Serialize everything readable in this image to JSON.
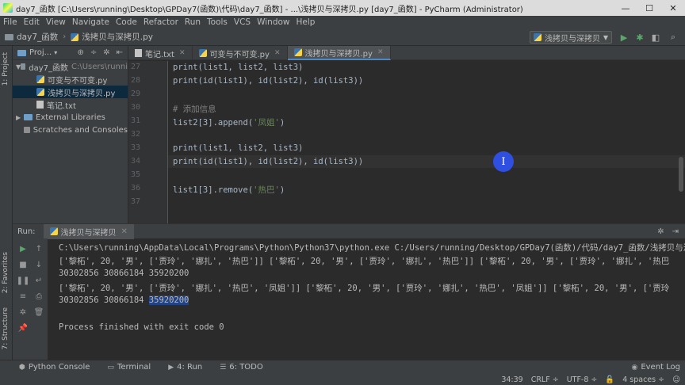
{
  "window": {
    "title": "day7_函数 [C:\\Users\\running\\Desktop\\GPDay7(函数)\\代码\\day7_函数] - ...\\浅拷贝与深拷贝.py [day7_函数] - PyCharm (Administrator)",
    "controls": [
      "—",
      "☐",
      "✕"
    ]
  },
  "menu": [
    "File",
    "Edit",
    "View",
    "Navigate",
    "Code",
    "Refactor",
    "Run",
    "Tools",
    "VCS",
    "Window",
    "Help"
  ],
  "breadcrumb": {
    "project": "day7_函数",
    "file": "浅拷贝与深拷贝.py"
  },
  "run_config": {
    "label": "浅拷贝与深拷贝"
  },
  "left_strip": {
    "project_tab": "1: Project",
    "favorites_tab": "2: Favorites",
    "structure_tab": "7: Structure"
  },
  "project_panel": {
    "header": "Proj...",
    "root": {
      "name": "day7_函数",
      "path": "C:\\Users\\runni"
    },
    "files": [
      {
        "name": "可变与不可变.py"
      },
      {
        "name": "浅拷贝与深拷贝.py"
      },
      {
        "name": "笔记.txt"
      }
    ],
    "external": "External Libraries",
    "scratches": "Scratches and Consoles"
  },
  "editor_tabs": [
    {
      "label": "笔记.txt"
    },
    {
      "label": "可变与不可变.py"
    },
    {
      "label": "浅拷贝与深拷贝.py"
    }
  ],
  "editor": {
    "line_numbers": [
      "27",
      "28",
      "29",
      "30",
      "31",
      "32",
      "33",
      "34",
      "35",
      "36",
      "37"
    ],
    "lines": {
      "l27": "print(list1, list2, list3)",
      "l28": "print(id(list1), id(list2), id(list3))",
      "l30": "# 添加信息",
      "l31a": "list2[3].append(",
      "l31s": "'凤姐'",
      "l31b": ")",
      "l33": "print(list1, list2, list3)",
      "l34": "print(id(list1), id(list2), id(list3))",
      "l36a": "list1[3].remove(",
      "l36s": "'热巴'",
      "l36b": ")"
    },
    "cursor_glyph": "I"
  },
  "run_panel": {
    "label": "Run:",
    "tab": "浅拷贝与深拷贝",
    "output": [
      "C:\\Users\\running\\AppData\\Local\\Programs\\Python\\Python37\\python.exe C:/Users/running/Desktop/GPDay7(函数)/代码/day7_函数/浅拷贝与深",
      "['黎柘', 20, '男', ['贾玲', '娜扎', '热巴']] ['黎柘', 20, '男', ['贾玲', '娜扎', '热巴']] ['黎柘', 20, '男', ['贾玲', '娜扎', '热巴",
      "30302856 30866184 35920200",
      "['黎柘', 20, '男', ['贾玲', '娜扎', '热巴', '凤姐']] ['黎柘', 20, '男', ['贾玲', '娜扎', '热巴', '凤姐']] ['黎柘', 20, '男', ['贾玲",
      "30302856 30866184 ",
      "35920200",
      "",
      "Process finished with exit code 0"
    ]
  },
  "bottom_tabs": [
    {
      "label": "Python Console",
      "icon": "python-icon"
    },
    {
      "label": "Terminal",
      "icon": "terminal-icon"
    },
    {
      "label": "4: Run",
      "icon": "run-icon"
    },
    {
      "label": "6: TODO",
      "icon": "todo-icon"
    }
  ],
  "event_log": "Event Log",
  "status": {
    "position": "34:39",
    "line_sep": "CRLF ÷",
    "encoding": "UTF-8 ÷",
    "indent": "4 spaces ÷"
  }
}
